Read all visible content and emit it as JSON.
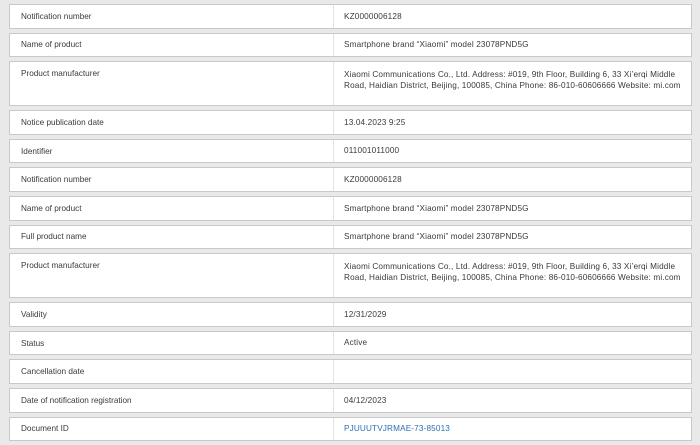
{
  "rows": [
    {
      "label": "Notification number",
      "value": "KZ0000006128"
    },
    {
      "label": "Name of product",
      "value": "Smartphone brand “Xiaomi” model 23078PND5G"
    },
    {
      "label": "Product manufacturer",
      "value": "Xiaomi Communications Co., Ltd. Address: #019, 9th Floor, Building 6, 33 Xi’erqi Middle Road, Haidian District, Beijing, 100085, China Phone: 86-010-60606666 Website: mi.com"
    },
    {
      "label": "Notice publication date",
      "value": "13.04.2023 9:25"
    },
    {
      "label": "Identifier",
      "value": "011001011000"
    },
    {
      "label": "Notification number",
      "value": "KZ0000006128"
    },
    {
      "label": "Name of product",
      "value": "Smartphone brand “Xiaomi” model 23078PND5G"
    },
    {
      "label": "Full product name",
      "value": "Smartphone brand “Xiaomi” model 23078PND5G"
    },
    {
      "label": "Product manufacturer",
      "value": "Xiaomi Communications Co., Ltd. Address: #019, 9th Floor, Building 6, 33 Xi’erqi Middle Road, Haidian District, Beijing, 100085, China Phone: 86-010-60606666 Website: mi.com"
    },
    {
      "label": "Validity",
      "value": "12/31/2029"
    },
    {
      "label": "Status",
      "value": "Active"
    },
    {
      "label": "Cancellation date",
      "value": ""
    },
    {
      "label": "Date of notification registration",
      "value": "04/12/2023"
    },
    {
      "label": "Document ID",
      "value": "PJUUUTVJRMAE-73-85013"
    }
  ]
}
